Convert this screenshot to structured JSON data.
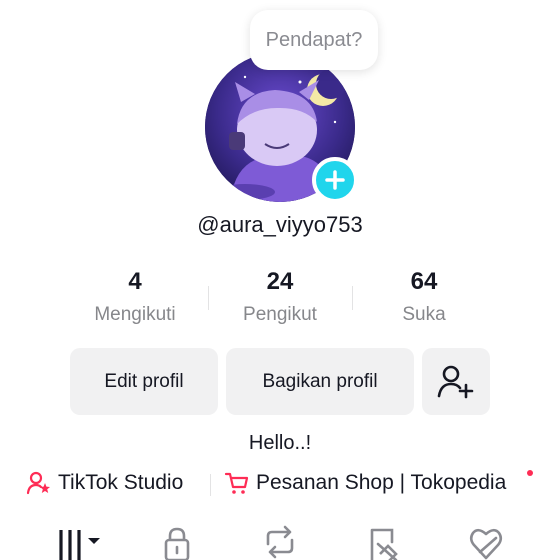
{
  "profile": {
    "bubble_text": "Pendapat?",
    "username": "@aura_viyyo753",
    "bio": "Hello..!"
  },
  "stats": [
    {
      "value": "4",
      "label": "Mengikuti"
    },
    {
      "value": "24",
      "label": "Pengikut"
    },
    {
      "value": "64",
      "label": "Suka"
    }
  ],
  "buttons": {
    "edit": "Edit profil",
    "share": "Bagikan profil"
  },
  "links": {
    "studio": "TikTok Studio",
    "shop": "Pesanan Shop | Tokopedia"
  },
  "colors": {
    "accent_pink": "#fe2c55",
    "plus_blue": "#20d5ec"
  },
  "tabs": [
    "grid-icon",
    "lock-icon",
    "repost-icon",
    "saved-icon",
    "liked-icon"
  ]
}
